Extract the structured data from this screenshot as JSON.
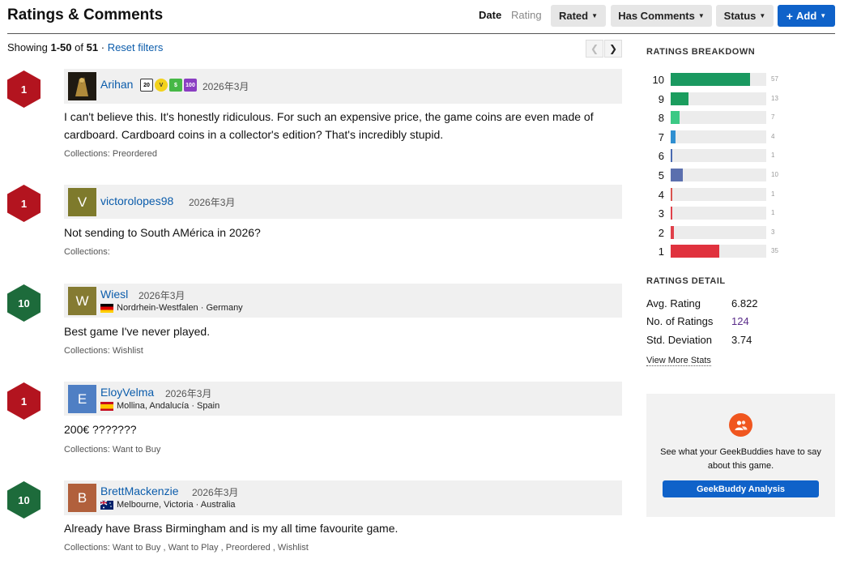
{
  "header": {
    "title": "Ratings & Comments",
    "sort_date": "Date",
    "sort_rating": "Rating",
    "rated": "Rated",
    "has_comments": "Has Comments",
    "status": "Status",
    "add": "Add"
  },
  "showing": {
    "prefix": "Showing",
    "range": "1-50",
    "of": "of",
    "total": "51",
    "sep": "·",
    "reset": "Reset filters"
  },
  "reviews": [
    {
      "rating": "1",
      "username": "Arihan",
      "date": "2026年3月",
      "location": "",
      "avatar_letter": "",
      "comment": "I can't believe this. It's honestly ridiculous. For such an expensive price, the game coins are even made of cardboard. Cardboard coins in a collector's edition? That's incredibly stupid.",
      "collections": "Collections: Preordered",
      "badges": [
        "20",
        "V",
        "$",
        "100"
      ]
    },
    {
      "rating": "1",
      "username": "victorolopes98",
      "date": "2026年3月",
      "location": "",
      "avatar_letter": "V",
      "comment": "Not sending to South AMérica in 2026?",
      "collections": "Collections:"
    },
    {
      "rating": "10",
      "username": "Wiesl",
      "date": "2026年3月",
      "location": "Nordrhein-Westfalen · Germany",
      "avatar_letter": "W",
      "comment": "Best game I've never played.",
      "collections": "Collections: Wishlist"
    },
    {
      "rating": "1",
      "username": "EloyVelma",
      "date": "2026年3月",
      "location": "Mollina, Andalucía · Spain",
      "avatar_letter": "E",
      "comment": "200€ ???????",
      "collections": "Collections: Want to Buy"
    },
    {
      "rating": "10",
      "username": "BrettMackenzie",
      "date": "2026年3月",
      "location": "Melbourne, Victoria · Australia",
      "avatar_letter": "B",
      "comment": "Already have Brass Birmingham and is my all time favourite game.",
      "collections": "Collections: Want to Buy , Want to Play , Preordered , Wishlist"
    }
  ],
  "breakdown": {
    "title": "RATINGS BREAKDOWN",
    "rows": [
      {
        "label": "10",
        "count": "57",
        "fraction": 0.829,
        "color": "#1a9960"
      },
      {
        "label": "9",
        "count": "13",
        "fraction": 0.19,
        "color": "#1b9d5e"
      },
      {
        "label": "8",
        "count": "7",
        "fraction": 0.095,
        "color": "#3cc985"
      },
      {
        "label": "7",
        "count": "4",
        "fraction": 0.05,
        "color": "#2f8fd1"
      },
      {
        "label": "6",
        "count": "1",
        "fraction": 0.012,
        "color": "#4a6ab0"
      },
      {
        "label": "5",
        "count": "10",
        "fraction": 0.13,
        "color": "#5b6fae"
      },
      {
        "label": "4",
        "count": "1",
        "fraction": 0.012,
        "color": "#d9534f"
      },
      {
        "label": "3",
        "count": "1",
        "fraction": 0.012,
        "color": "#e0404a"
      },
      {
        "label": "2",
        "count": "3",
        "fraction": 0.035,
        "color": "#e0404a"
      },
      {
        "label": "1",
        "count": "35",
        "fraction": 0.51,
        "color": "#e0323e"
      }
    ]
  },
  "detail": {
    "title": "RATINGS DETAIL",
    "avg_label": "Avg. Rating",
    "avg_value": "6.822",
    "num_label": "No. of Ratings",
    "num_value": "124",
    "std_label": "Std. Deviation",
    "std_value": "3.74",
    "view_more": "View More Stats"
  },
  "buddy": {
    "text": "See what your GeekBuddies have to say about this game.",
    "button": "GeekBuddy Analysis"
  }
}
